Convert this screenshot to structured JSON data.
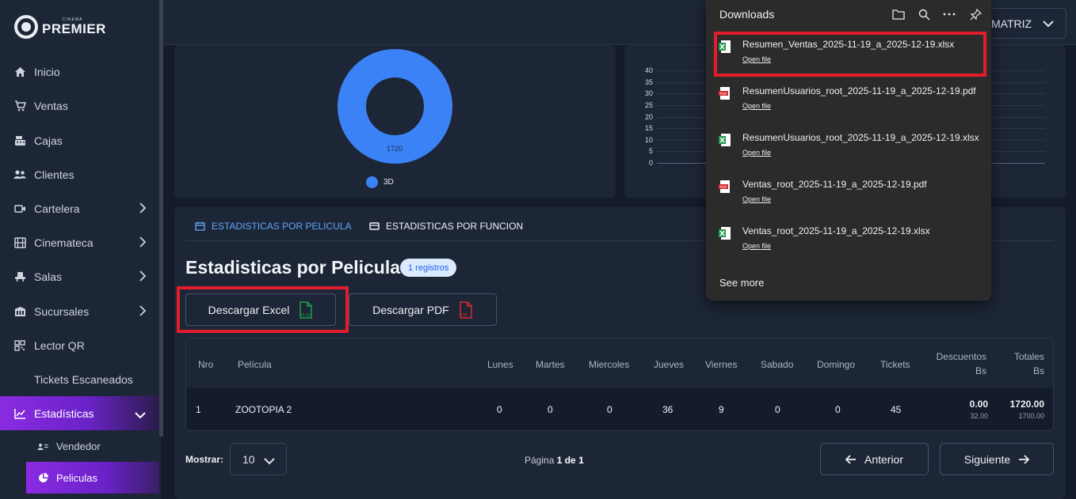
{
  "brand": {
    "small": "CINEMA",
    "name": "PREMIER"
  },
  "sidebar": {
    "items": [
      {
        "label": "Inicio",
        "icon": "home-icon"
      },
      {
        "label": "Ventas",
        "icon": "cart-icon"
      },
      {
        "label": "Cajas",
        "icon": "cash-register-icon"
      },
      {
        "label": "Clientes",
        "icon": "users-icon"
      },
      {
        "label": "Cartelera",
        "icon": "film-camera-icon"
      },
      {
        "label": "Cinemateca",
        "icon": "film-icon"
      },
      {
        "label": "Salas",
        "icon": "seat-icon"
      },
      {
        "label": "Sucursales",
        "icon": "building-icon"
      },
      {
        "label": "Lector QR",
        "icon": "qr-icon"
      },
      {
        "label": "Tickets Escaneados",
        "icon": "ticket-icon"
      },
      {
        "label": "Estadísticas",
        "icon": "chart-line-icon"
      }
    ],
    "subitems": [
      {
        "label": "Vendedor",
        "icon": "id-card-icon"
      },
      {
        "label": "Peliculas",
        "icon": "pie-chart-icon"
      }
    ]
  },
  "header": {
    "branch": "MATRIZ"
  },
  "donut_chart": {
    "chart_data": {
      "type": "pie",
      "slices": [
        {
          "label": "3D",
          "value": 1720
        }
      ],
      "data_label": "1720",
      "legend": [
        "3D"
      ]
    }
  },
  "bar_chart": {
    "chart_data": {
      "type": "bar",
      "yticks": [
        "40",
        "35",
        "30",
        "25",
        "20",
        "15",
        "10",
        "5",
        "0"
      ],
      "ylim": [
        0,
        40
      ]
    }
  },
  "tabs": [
    {
      "label": "ESTADISTICAS POR PELICULA",
      "active": true
    },
    {
      "label": "ESTADISTICAS POR FUNCION",
      "active": false
    }
  ],
  "section": {
    "title": "Estadisticas por Pelicula",
    "badge": "1 registros"
  },
  "buttons": {
    "excel": "Descargar Excel",
    "excel_icon_text": "XLSX",
    "pdf": "Descargar PDF",
    "pdf_icon_text": "PDF"
  },
  "table": {
    "headers": {
      "nro": "Nro",
      "pelicula": "Película",
      "lunes": "Lunes",
      "martes": "Martes",
      "miercoles": "Miercoles",
      "jueves": "Jueves",
      "viernes": "Viernes",
      "sabado": "Sabado",
      "domingo": "Domingo",
      "tickets": "Tickets",
      "descuentos": "Descuentos",
      "descuentos_unit": "Bs",
      "totales": "Totales",
      "totales_unit": "Bs"
    },
    "rows": [
      {
        "nro": "1",
        "pelicula": "ZOOTOPIA 2",
        "lunes": "0",
        "martes": "0",
        "miercoles": "0",
        "jueves": "36",
        "viernes": "9",
        "sabado": "0",
        "domingo": "0",
        "tickets": "45",
        "descuentos": "0.00",
        "descuentos_sub": "32.00",
        "totales": "1720.00",
        "totales_sub": "1700.00"
      }
    ]
  },
  "pagination": {
    "show_label": "Mostrar:",
    "per_page": "10",
    "page_prefix": "Página",
    "page_info": "1 de 1",
    "prev": "Anterior",
    "next": "Siguiente"
  },
  "downloads": {
    "title": "Downloads",
    "items": [
      {
        "name": "Resumen_Ventas_2025-11-19_a_2025-12-19.xlsx",
        "type": "xlsx",
        "action": "Open file"
      },
      {
        "name": "ResumenUsuarios_root_2025-11-19_a_2025-12-19.pdf",
        "type": "pdf",
        "action": "Open file"
      },
      {
        "name": "ResumenUsuarios_root_2025-11-19_a_2025-12-19.xlsx",
        "type": "xlsx",
        "action": "Open file"
      },
      {
        "name": "Ventas_root_2025-11-19_a_2025-12-19.pdf",
        "type": "pdf",
        "action": "Open file"
      },
      {
        "name": "Ventas_root_2025-11-19_a_2025-12-19.xlsx",
        "type": "xlsx",
        "action": "Open file"
      }
    ],
    "see_more": "See more"
  },
  "colors": {
    "accent_purple": "#8a2be2",
    "accent_blue": "#3b82f6",
    "highlight_red": "#e11d2b",
    "excel_green": "#1f9d4c",
    "pdf_red": "#d92a2a"
  }
}
